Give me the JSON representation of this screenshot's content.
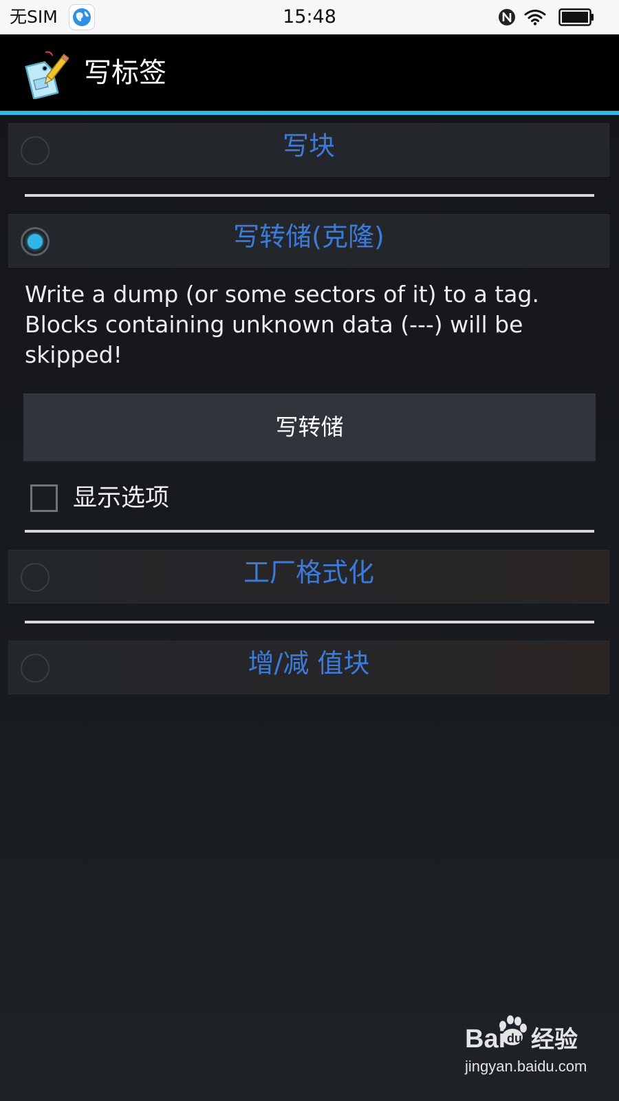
{
  "status_bar": {
    "carrier": "无SIM",
    "time": "15:48"
  },
  "action_bar": {
    "title": "写标签"
  },
  "options": [
    {
      "label": "写块",
      "selected": false
    },
    {
      "label": "写转储(克隆)",
      "selected": true
    },
    {
      "label": "工厂格式化",
      "selected": false
    },
    {
      "label": "增/减 值块",
      "selected": false
    }
  ],
  "write_dump": {
    "description": "Write a dump (or some sectors of it) to a tag. Blocks containing unknown data (---) will be skipped!",
    "button_label": "写转储",
    "show_options_label": "显示选项",
    "show_options_checked": false
  },
  "watermark": {
    "brand": "Bai",
    "brand_suffix": "经验",
    "url": "jingyan.baidu.com"
  },
  "colors": {
    "accent": "#33b5e5",
    "option_label": "#3c7bd9",
    "action_bar": "#000000",
    "status_bar": "#f7f7f7"
  }
}
